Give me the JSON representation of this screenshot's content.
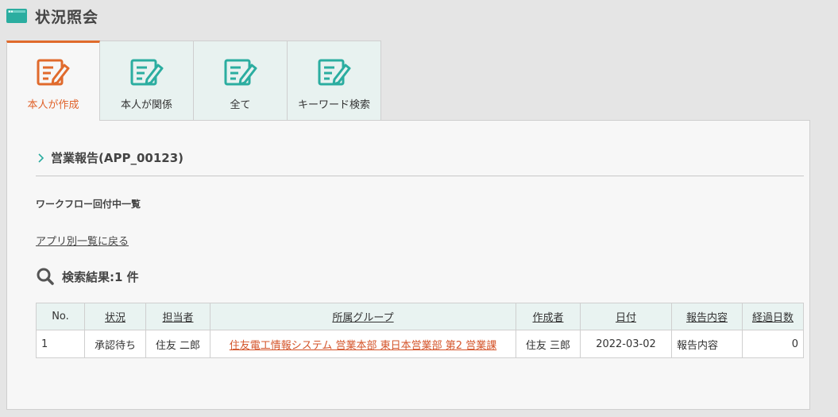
{
  "header": {
    "title": "状況照会",
    "icon": "window-icon"
  },
  "tabs": [
    {
      "label": "本人が作成",
      "icon": "edit-document-icon",
      "active": true
    },
    {
      "label": "本人が関係",
      "icon": "edit-document-icon",
      "active": false
    },
    {
      "label": "全て",
      "icon": "edit-document-icon",
      "active": false
    },
    {
      "label": "キーワード検索",
      "icon": "edit-document-icon",
      "active": false
    }
  ],
  "main": {
    "app_title": "営業報告(APP_00123)",
    "section_title": "ワークフロー回付中一覧",
    "back_link": "アプリ別一覧に戻る",
    "result_text": "検索結果:1 件"
  },
  "table": {
    "columns": [
      "No.",
      "状況",
      "担当者",
      "所属グループ",
      "作成者",
      "日付",
      "報告内容",
      "経過日数"
    ],
    "rows": [
      [
        "1",
        "承認待ち",
        "住友 二郎",
        "住友電工情報システム 営業本部 東日本営業部 第2 営業課",
        "住友 三郎",
        "2022-03-02",
        "報告内容",
        "0"
      ]
    ]
  },
  "colors": {
    "accent_orange": "#e06a2c",
    "teal": "#2bada0",
    "tab_bg": "#e8f2f0",
    "link_orange": "#d4542a"
  }
}
